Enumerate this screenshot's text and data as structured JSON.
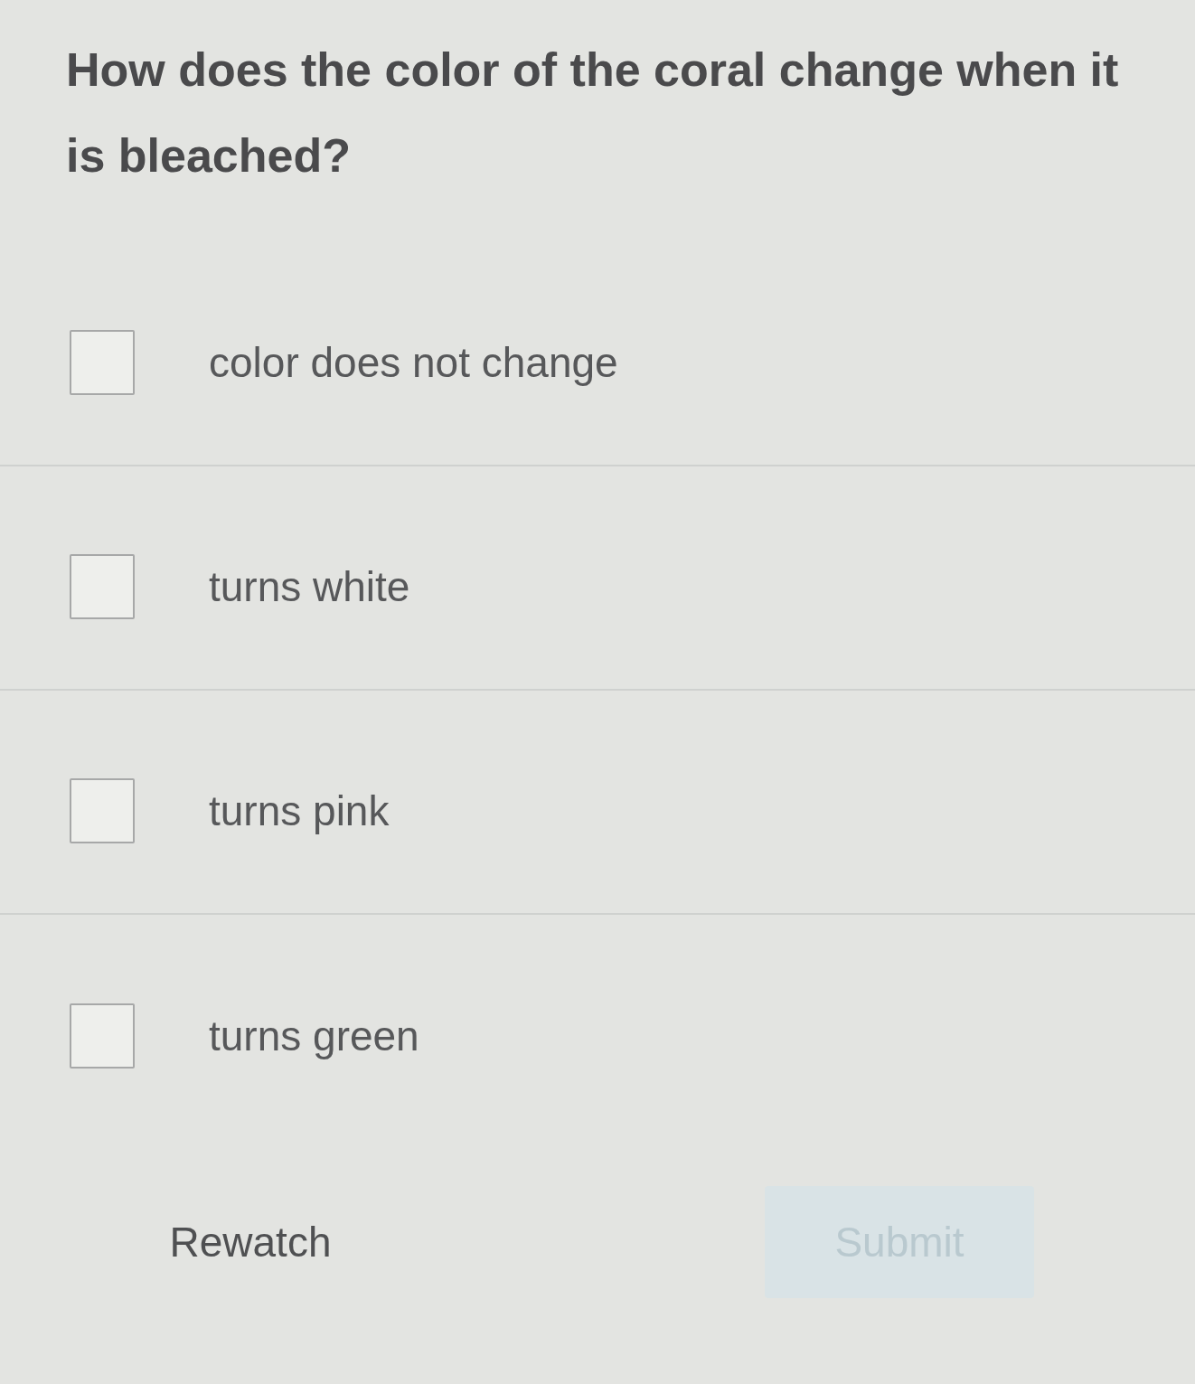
{
  "question": "How does the color of the coral change when it is bleached?",
  "options": [
    {
      "label": "color does not change",
      "checked": false
    },
    {
      "label": "turns white",
      "checked": false
    },
    {
      "label": "turns pink",
      "checked": false
    },
    {
      "label": "turns green",
      "checked": false
    }
  ],
  "buttons": [
    {
      "kind": "text",
      "label": "Rewatch",
      "disabled": false
    },
    {
      "kind": "primary",
      "label": "Submit",
      "disabled": true
    }
  ]
}
